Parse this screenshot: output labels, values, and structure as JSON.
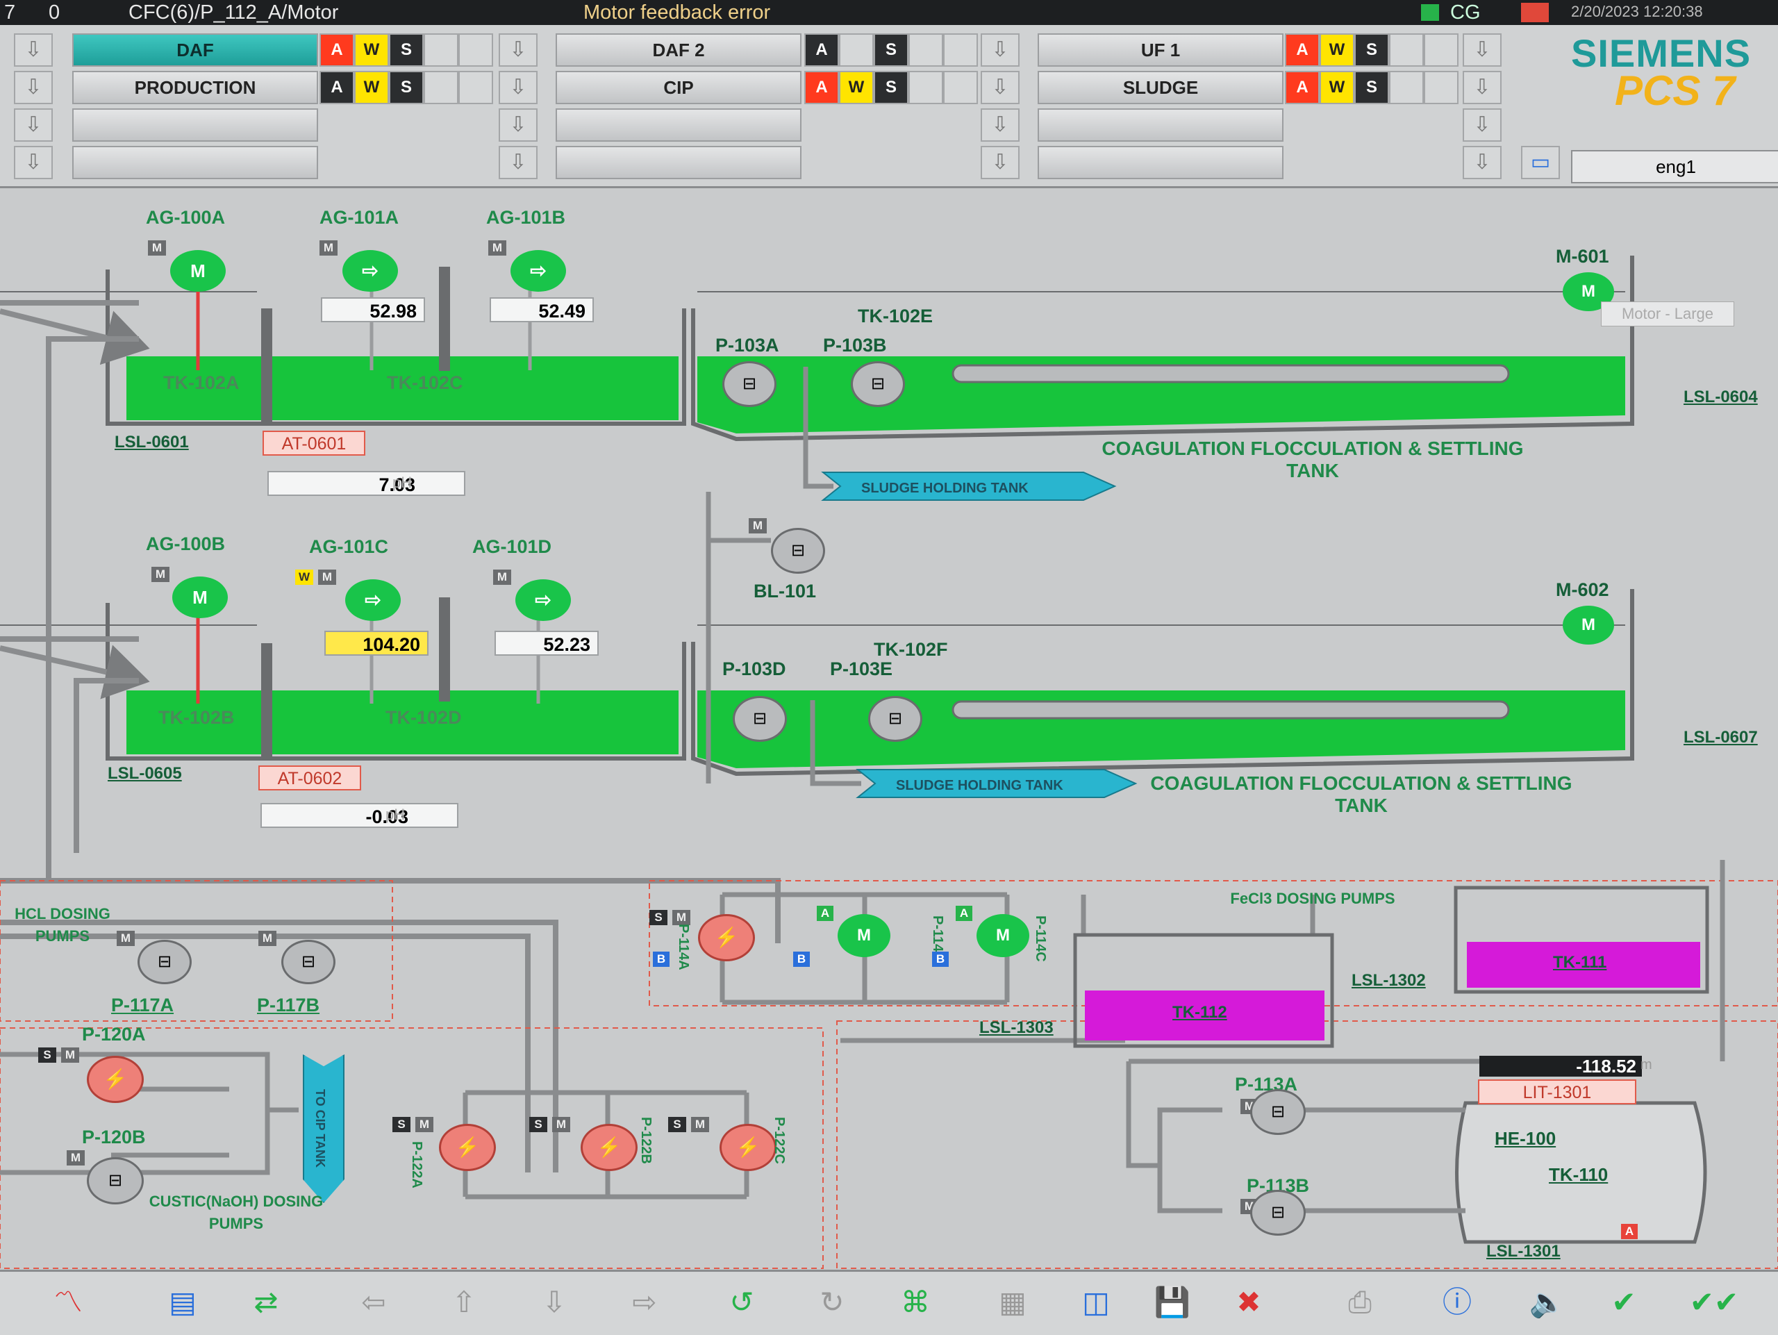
{
  "alarm_bar": {
    "priority": "7",
    "count": "0",
    "source": "CFC(6)/P_112_A/Motor",
    "message": "Motor feedback error",
    "station": "CG",
    "datetime": "2/20/2023 12:20:38"
  },
  "areas": {
    "row1": [
      "DAF",
      "DAF 2",
      "UF 1"
    ],
    "row2": [
      "PRODUCTION",
      "CIP",
      "SLUDGE"
    ],
    "a_label": "A",
    "w_label": "W",
    "s_label": "S"
  },
  "brand": {
    "siemens": "SIEMENS",
    "product": "PCS 7"
  },
  "user": "eng1",
  "train1": {
    "ag100": "AG-100A",
    "ag101a": "AG-101A",
    "ag101b": "AG-101B",
    "speed_a": "52.98",
    "speed_b": "52.49",
    "tk_a": "TK-102A",
    "tk_c": "TK-102C",
    "tk_e": "TK-102E",
    "pump_a": "P-103A",
    "pump_b": "P-103B",
    "motor": "M-601",
    "motor_tooltip": "Motor - Large",
    "lsl_left": "LSL-0601",
    "lsl_right": "LSL-0604",
    "analyzer": "AT-0601",
    "ph_value": "7.03",
    "ph_unit": "pH",
    "title": "COAGULATION FLOCCULATION & SETTLING TANK"
  },
  "sludge_label": "SLUDGE HOLDING TANK",
  "blower": "BL-101",
  "train2": {
    "ag100": "AG-100B",
    "ag101a": "AG-101C",
    "ag101b": "AG-101D",
    "speed_a": "104.20",
    "speed_b": "52.23",
    "tk_a": "TK-102B",
    "tk_c": "TK-102D",
    "tk_e": "TK-102F",
    "pump_a": "P-103D",
    "pump_b": "P-103E",
    "motor": "M-602",
    "lsl_left": "LSL-0605",
    "lsl_right": "LSL-0607",
    "analyzer": "AT-0602",
    "ph_value": "-0.03",
    "ph_unit": "pH",
    "title": "COAGULATION FLOCCULATION & SETTLING TANK"
  },
  "dosing": {
    "hcl_title": "HCL DOSING PUMPS",
    "p117a": "P-117A",
    "p117b": "P-117B",
    "p120a": "P-120A",
    "p120b": "P-120B",
    "caustic_title": "CUSTIC(NaOH) DOSING PUMPS",
    "cip_tank": "TO CIP TANK",
    "fecl3_title": "FeCl3 DOSING PUMPS",
    "p114a": "P-114A",
    "p114b": "P-114B",
    "p114c": "P-114C",
    "tk112": "TK-112",
    "tk111": "TK-111",
    "lsl1302": "LSL-1302",
    "lsl1303": "LSL-1303",
    "p122a": "P-122A",
    "p122b": "P-122B",
    "p122c": "P-122C"
  },
  "tank110": {
    "level_value": "-118.52",
    "level_unit": "m",
    "lit": "LIT-1301",
    "p113a": "P-113A",
    "p113b": "P-113B",
    "he": "HE-100",
    "tk": "TK-110",
    "lsl": "LSL-1301"
  },
  "colors": {
    "water": "#17c43c",
    "chem": "#d51ad9",
    "running": "#19c44a",
    "fault": "#e8433a"
  }
}
